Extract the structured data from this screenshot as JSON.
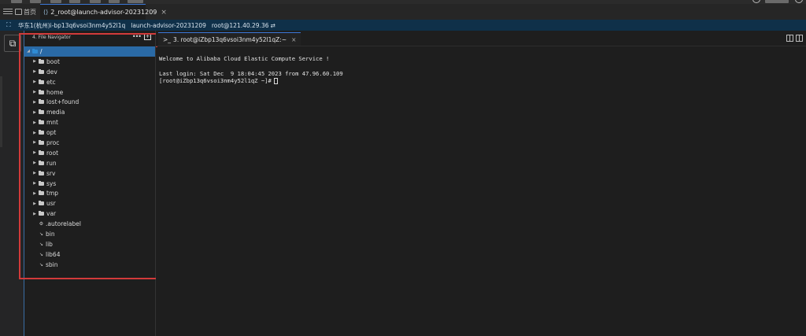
{
  "tabbar": {
    "home_tab": "首页",
    "active_tab": "2_root@launch-advisor-20231209"
  },
  "infobar": {
    "region": "华东1(杭州)",
    "instance_id": "i-bp13q6vsoi3nm4y52l1q",
    "instance_name": "launch-advisor-20231209",
    "connection": "root@121.40.29.36"
  },
  "navigator": {
    "title": "4. File Navigator",
    "root": "/",
    "folders": [
      "boot",
      "dev",
      "etc",
      "home",
      "lost+found",
      "media",
      "mnt",
      "opt",
      "proc",
      "root",
      "run",
      "srv",
      "sys",
      "tmp",
      "usr",
      "var"
    ],
    "files": [
      ".autorelabel"
    ],
    "links": [
      "bin",
      "lib",
      "lib64",
      "sbin"
    ]
  },
  "terminal": {
    "tab_label": "3. root@iZbp13q6vsoi3nm4y52l1qZ:~",
    "welcome": "Welcome to Alibaba Cloud Elastic Compute Service !",
    "last_login": "Last login: Sat Dec  9 18:04:45 2023 from 47.96.60.109",
    "prompt": "[root@iZbp13q6vsoi3nm4y52l1qZ ~]#"
  }
}
